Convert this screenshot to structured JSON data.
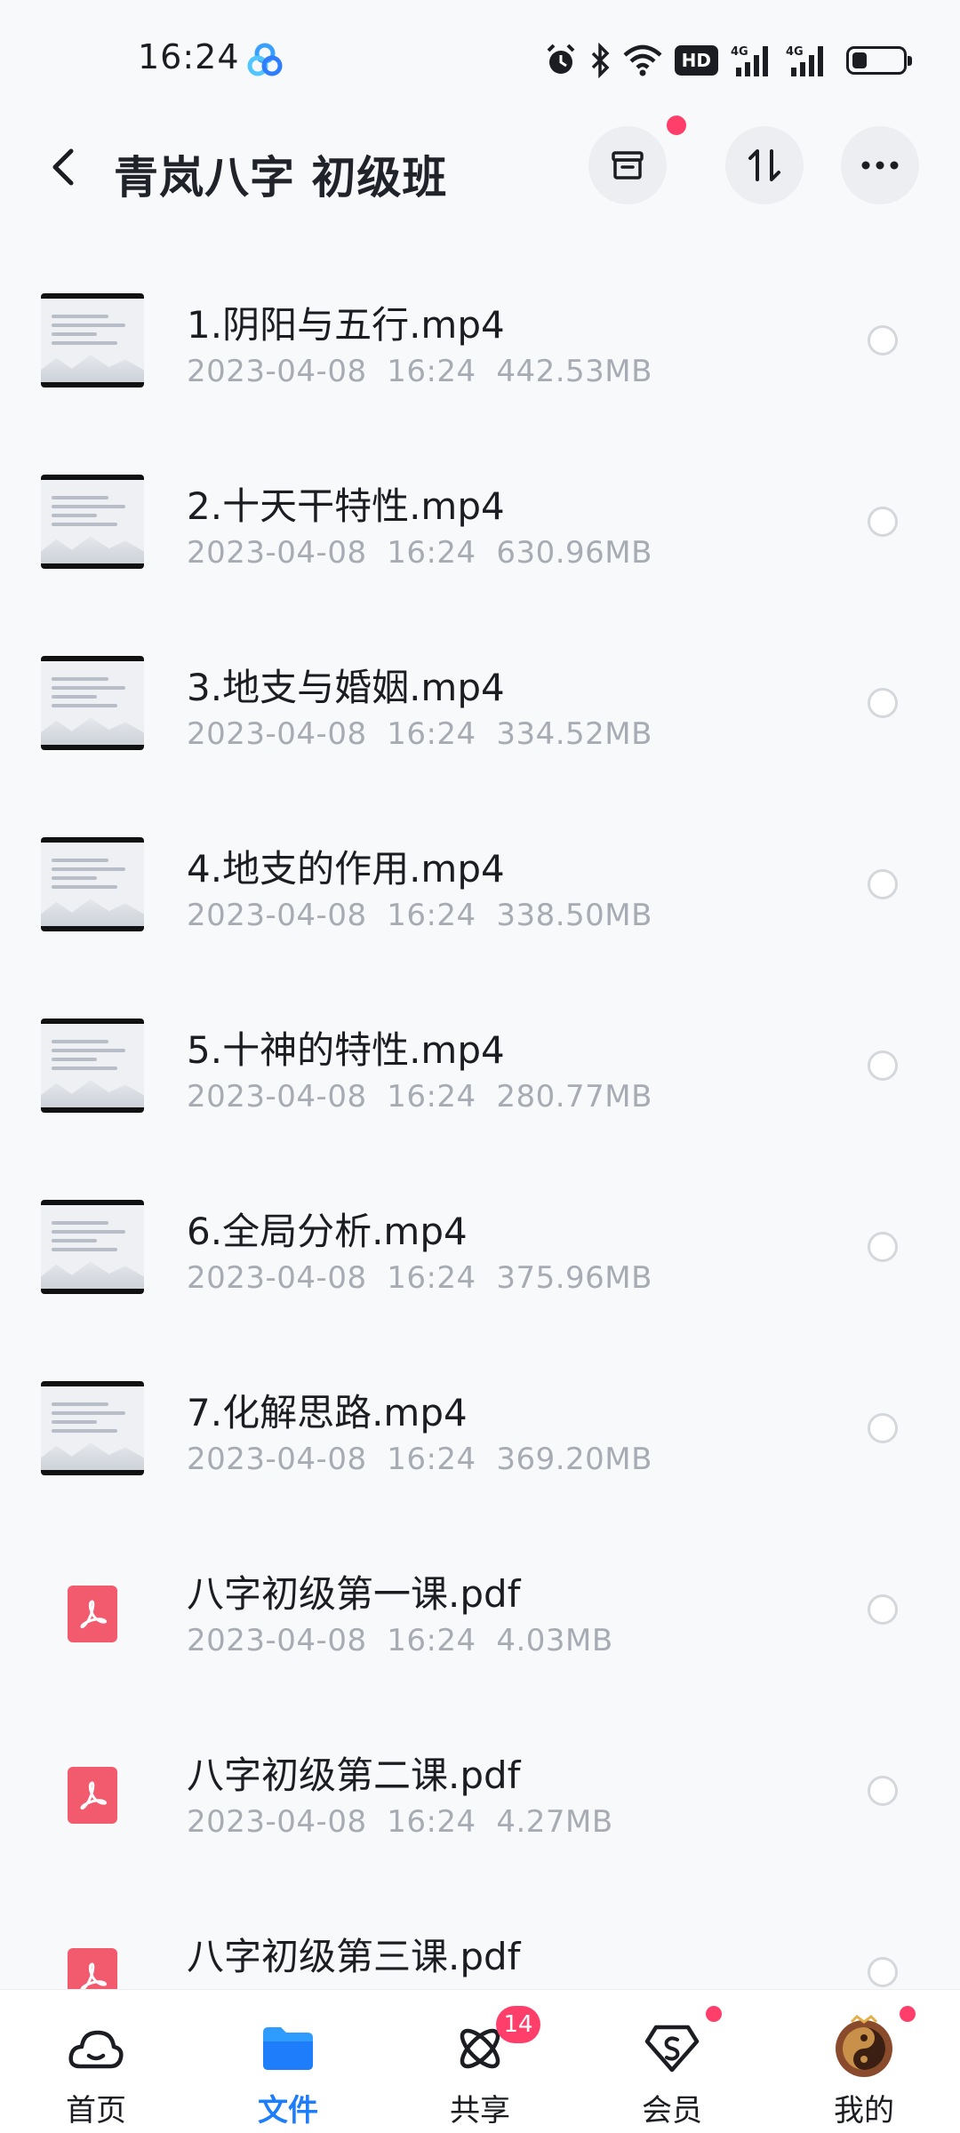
{
  "status_bar": {
    "time": "16:24",
    "hd_label": "HD",
    "battery_level": 0.3
  },
  "header": {
    "title": "青岚八字 初级班"
  },
  "files": [
    {
      "name": "1.阴阳与五行.mp4",
      "date": "2023-04-08  16:24",
      "size": "442.53MB",
      "kind": "video"
    },
    {
      "name": "2.十天干特性.mp4",
      "date": "2023-04-08  16:24",
      "size": "630.96MB",
      "kind": "video"
    },
    {
      "name": "3.地支与婚姻.mp4",
      "date": "2023-04-08  16:24",
      "size": "334.52MB",
      "kind": "video"
    },
    {
      "name": "4.地支的作用.mp4",
      "date": "2023-04-08  16:24",
      "size": "338.50MB",
      "kind": "video"
    },
    {
      "name": "5.十神的特性.mp4",
      "date": "2023-04-08  16:24",
      "size": "280.77MB",
      "kind": "video"
    },
    {
      "name": "6.全局分析.mp4",
      "date": "2023-04-08  16:24",
      "size": "375.96MB",
      "kind": "video"
    },
    {
      "name": "7.化解思路.mp4",
      "date": "2023-04-08  16:24",
      "size": "369.20MB",
      "kind": "video"
    },
    {
      "name": "八字初级第一课.pdf",
      "date": "2023-04-08  16:24",
      "size": "4.03MB",
      "kind": "pdf"
    },
    {
      "name": "八字初级第二课.pdf",
      "date": "2023-04-08  16:24",
      "size": "4.27MB",
      "kind": "pdf"
    },
    {
      "name": "八字初级第三课.pdf",
      "date": "",
      "size": "",
      "kind": "pdf"
    }
  ],
  "nav": [
    {
      "label": "首页",
      "icon": "cloud-icon",
      "active": false
    },
    {
      "label": "文件",
      "icon": "folder-icon",
      "active": true
    },
    {
      "label": "共享",
      "icon": "share-orbit-icon",
      "active": false,
      "badge": "14"
    },
    {
      "label": "会员",
      "icon": "vip-diamond-icon",
      "active": false,
      "dot": true
    },
    {
      "label": "我的",
      "icon": "avatar-icon",
      "active": false,
      "dot": true
    }
  ],
  "colors": {
    "accent": "#1d7dfa",
    "badge": "#ff3f6a",
    "pdf": "#f25b6e",
    "meta_text": "#a7abb3"
  }
}
